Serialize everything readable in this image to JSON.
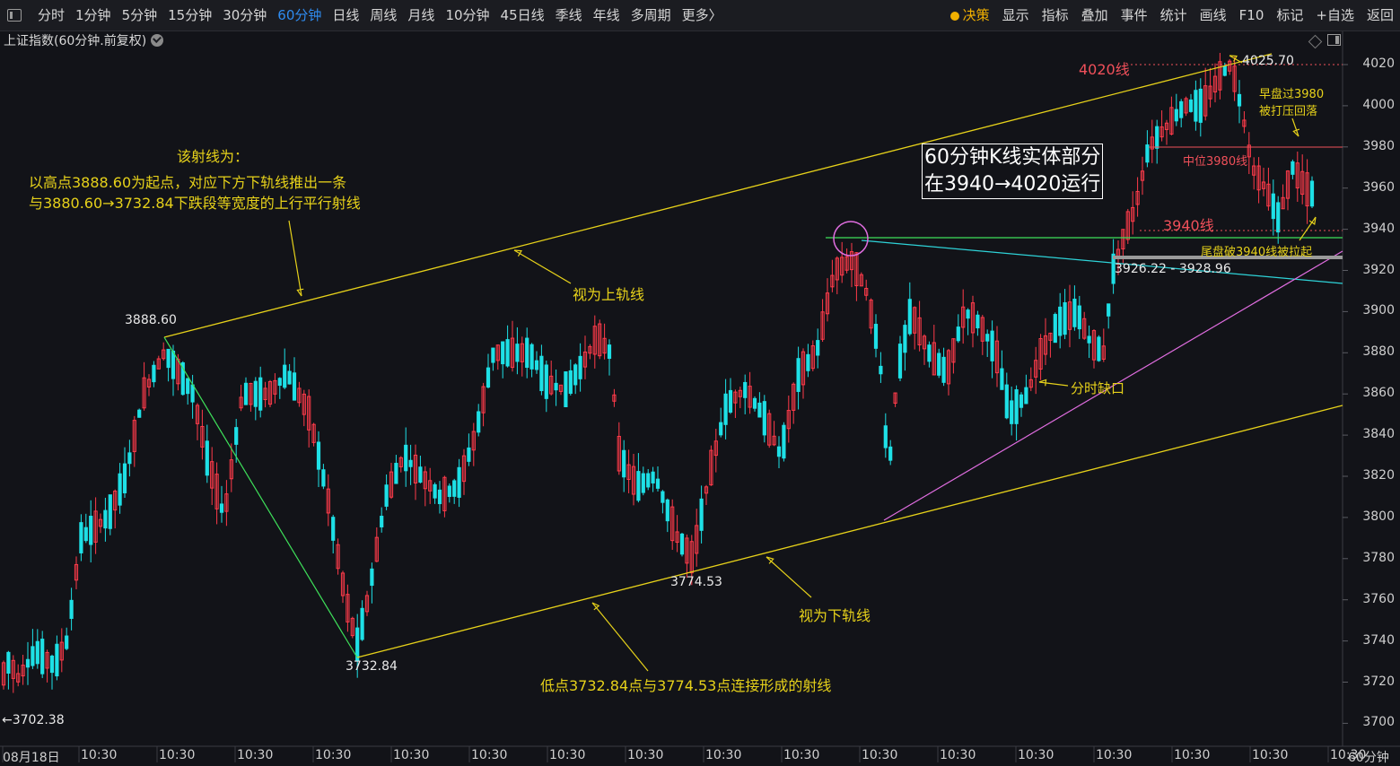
{
  "toolbar": {
    "tabs": [
      "分时",
      "1分钟",
      "5分钟",
      "15分钟",
      "30分钟",
      "60分钟",
      "日线",
      "周线",
      "月线",
      "10分钟",
      "45日线",
      "季线",
      "年线",
      "多周期",
      "更多〉"
    ],
    "active_tab": "60分钟",
    "right_items": [
      "决策",
      "显示",
      "指标",
      "叠加",
      "事件",
      "统计",
      "画线",
      "F10",
      "标记",
      "+自选",
      "返回"
    ]
  },
  "chart_title": "上证指数(60分钟.前复权)",
  "price_axis": [
    "4020",
    "4000",
    "3980",
    "3960",
    "3940",
    "3920",
    "3900",
    "3880",
    "3860",
    "3840",
    "3820",
    "3800",
    "3780",
    "3760",
    "3740",
    "3720",
    "3700"
  ],
  "time_axis": [
    "08月18日",
    "10:30",
    "10:30",
    "10:30",
    "10:30",
    "10:30",
    "10:30",
    "10:30",
    "10:30",
    "10:30",
    "10:30",
    "10:30",
    "10:30",
    "10:30",
    "10:30",
    "10:30",
    "10:30",
    "10:30"
  ],
  "period_label": "60分钟",
  "annotations": {
    "ray_title": "该射线为：",
    "ray_desc1": "以高点3888.60为起点，对应下方下轨线推出一条",
    "ray_desc2": "与3880.60→3732.84下跌段等宽度的上行平行射线",
    "upper_rail": "视为上轨线",
    "lower_rail": "视为下轨线",
    "low_line": "低点3732.84点与3774.53点连接形成的射线",
    "body_range1": "60分钟K线实体部分",
    "body_range2": "在3940→4020运行",
    "gap": "分时缺口",
    "morning1": "早盘过3980",
    "morning2": "被打压回落",
    "midline": "中位3980线",
    "tail": "尾盘破3940线被拉起",
    "line4020": "4020线",
    "line3940": "3940线",
    "gap_range": "3926.22 - 3928.96",
    "p3888": "3888.60",
    "p3732": "3732.84",
    "p3774": "3774.53",
    "p3702": "←3702.38",
    "p4025": "4025.70"
  },
  "colors": {
    "up": "#ff3b4a",
    "down": "#1ee0e6",
    "rail": "#e6d11a",
    "pink": "#e06de0",
    "green": "#3ee05a",
    "cyan": "#2ed3d8"
  }
}
